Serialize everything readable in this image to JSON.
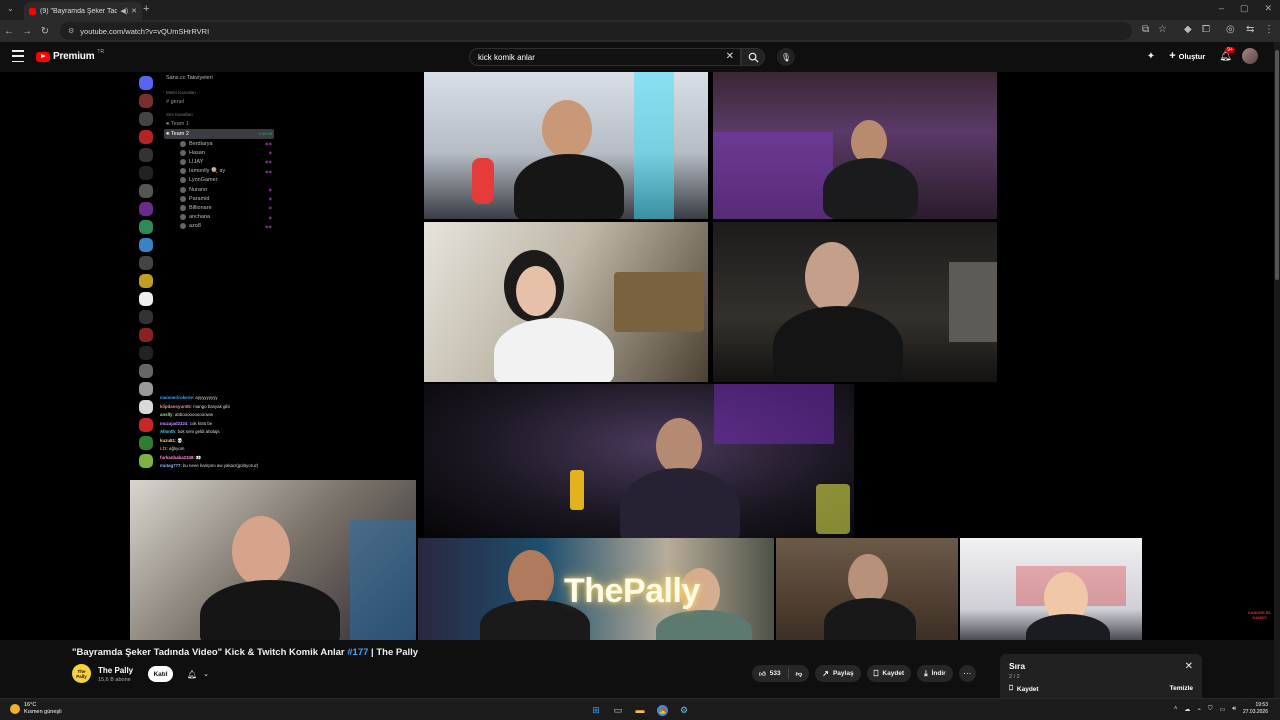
{
  "browser": {
    "tab_title": "(9) \"Bayramda Şeker Tadında",
    "url": "youtube.com/watch?v=vQUmSHrRVRI"
  },
  "youtube": {
    "logo_text": "Premium",
    "logo_sup": "TR",
    "search_query": "kick komik anlar",
    "create_label": "Oluştur",
    "notif_count": "9+"
  },
  "discord": {
    "server_title": "Sans.cc Takviyeleri",
    "text_section": "Metin Kanalları",
    "text_channel": "genel",
    "voice_section": "Ses Kanalları",
    "voice_channels": [
      "Team 1",
      "Team 2"
    ],
    "active_time": "2:45:38",
    "users": [
      "Berdiarya",
      "Hasan",
      "LİJAY",
      "Iamonlly 🍭 ay",
      "LyonGamer",
      "Nurano",
      "Paramid",
      "Billionare",
      "anchana",
      "azo8"
    ],
    "chat": [
      {
        "name": "mainnerirokerie",
        "text": "ayyyyyyyyy"
      },
      {
        "name": "klipdanoyun05",
        "text": "mango basyak gibi"
      },
      {
        "name": "anslly",
        "text": "abbooooooooooww"
      },
      {
        "name": "muzajad2324",
        "text": "cok kötü be"
      },
      {
        "name": "Allonth",
        "text": "bok seni geldi aholajs"
      },
      {
        "name": "kuzu81",
        "text": "💀"
      },
      {
        "name": "Lf3",
        "text": "ağlıyom"
      },
      {
        "name": "furkanbaba2348",
        "text": "👀"
      },
      {
        "name": "mutag777",
        "text": "bu neee kampını aw yakaız(gülüyoruz)"
      }
    ]
  },
  "overlay": {
    "brand_text": "ThePally",
    "watermark": "SANDRE BL GAMES"
  },
  "video": {
    "title_main": "\"Bayramda Şeker Tadında Video\" Kick & Twitch Komik Anlar ",
    "title_tag": "#177",
    "title_tail": " | The Pally",
    "channel_name": "The Pally",
    "channel_avatar_text": "The Pally",
    "subscribers": "15,6 B abone",
    "join_label": "Katıl",
    "likes": "533",
    "share_label": "Paylaş",
    "save_label": "Kaydet",
    "download_label": "İndir"
  },
  "queue": {
    "title": "Sıra",
    "count": "2 / 2",
    "save_label": "Kaydet",
    "clear_label": "Temizle"
  },
  "taskbar": {
    "temperature": "16°C",
    "weather_desc": "Kısmen güneşli",
    "time": "19:53",
    "date": "27.03.2026"
  },
  "colors": {
    "youtube_red": "#ff0000",
    "link_blue": "#3ea6ff",
    "background": "#0f0f0f"
  }
}
